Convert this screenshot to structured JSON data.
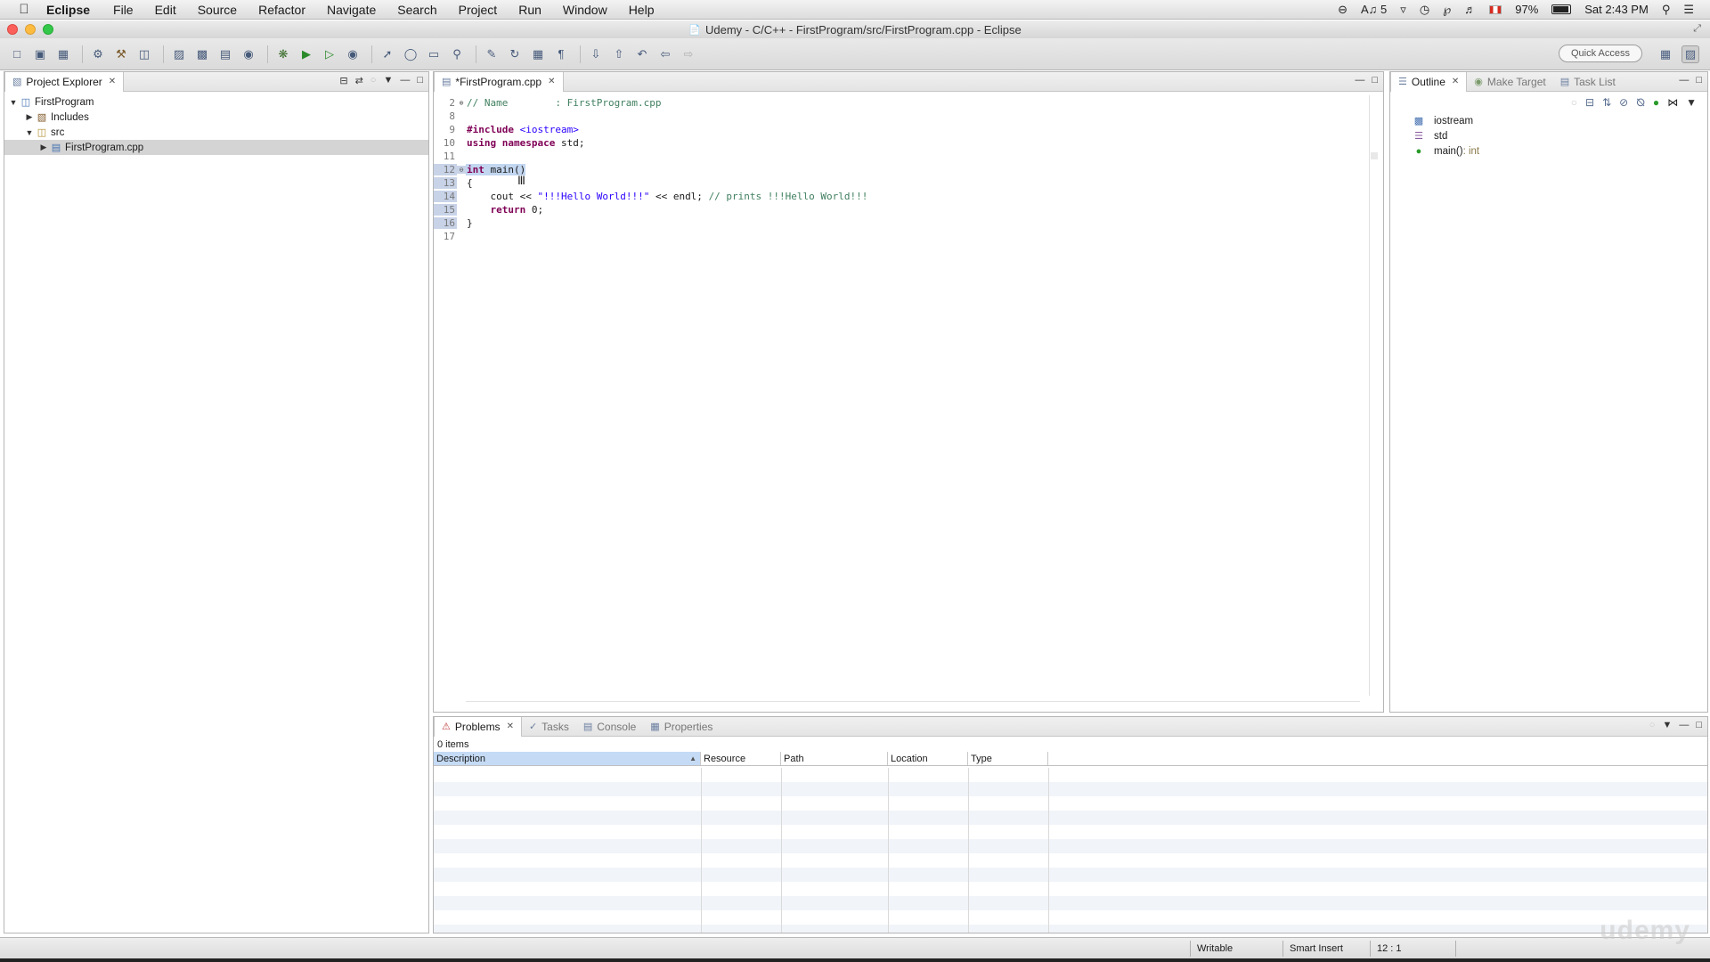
{
  "menubar": {
    "app_name": "Eclipse",
    "items": [
      "File",
      "Edit",
      "Source",
      "Refactor",
      "Navigate",
      "Search",
      "Project",
      "Run",
      "Window",
      "Help"
    ],
    "status": {
      "adobe": "5",
      "battery": "97%",
      "clock": "Sat 2:43 PM"
    }
  },
  "window": {
    "title": "Udemy - C/C++ - FirstProgram/src/FirstProgram.cpp - Eclipse"
  },
  "toolbar": {
    "quick_access": "Quick Access"
  },
  "project_explorer": {
    "tab_label": "Project Explorer",
    "tree": [
      {
        "label": "FirstProgram",
        "icon": "project-folder-icon",
        "expanded": true
      },
      {
        "label": "Includes",
        "icon": "includes-icon",
        "expanded": false
      },
      {
        "label": "src",
        "icon": "source-folder-icon",
        "expanded": true
      },
      {
        "label": "FirstProgram.cpp",
        "icon": "cpp-file-icon",
        "expanded": false,
        "selected": true
      }
    ]
  },
  "editor": {
    "tab_label": "*FirstProgram.cpp",
    "lines": [
      {
        "n": "2",
        "text": "// Name        : FirstProgram.cpp"
      },
      {
        "n": "8",
        "text": ""
      },
      {
        "n": "9",
        "text": "#include <iostream>"
      },
      {
        "n": "10",
        "text": "using namespace std;"
      },
      {
        "n": "11",
        "text": ""
      },
      {
        "n": "12",
        "text": "int main()"
      },
      {
        "n": "13",
        "text": "{"
      },
      {
        "n": "14",
        "text": "    cout << \"!!!Hello World!!!\" << endl; // prints !!!Hello World!!!"
      },
      {
        "n": "15",
        "text": "    return 0;"
      },
      {
        "n": "16",
        "text": "}"
      },
      {
        "n": "17",
        "text": ""
      }
    ]
  },
  "outline": {
    "tabs": [
      "Outline",
      "Make Target",
      "Task List"
    ],
    "items": [
      {
        "label": "iostream",
        "type": ""
      },
      {
        "label": "std",
        "type": ""
      },
      {
        "label": "main()",
        "type": " : int"
      }
    ]
  },
  "problems": {
    "tabs": [
      "Problems",
      "Tasks",
      "Console",
      "Properties"
    ],
    "count": "0 items",
    "columns": [
      "Description",
      "Resource",
      "Path",
      "Location",
      "Type"
    ]
  },
  "statusbar": {
    "writable": "Writable",
    "insert_mode": "Smart Insert",
    "position": "12 : 1"
  },
  "watermark": "udemy"
}
